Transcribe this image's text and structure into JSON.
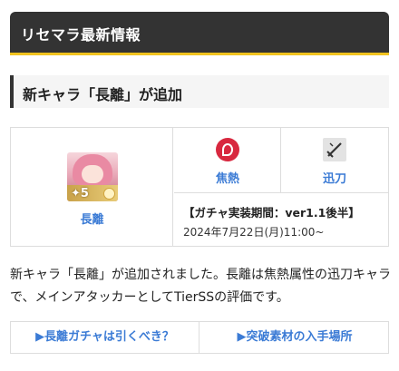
{
  "header": {
    "title": "リセマラ最新情報"
  },
  "sub_heading": {
    "text": "新キャラ「長離」が追加"
  },
  "character": {
    "rarity": "5",
    "name": "長離",
    "attribute": {
      "label": "焦熱",
      "icon": "fire-attribute-icon",
      "color": "#d8283f"
    },
    "weapon": {
      "label": "迅刀",
      "icon": "sword-weapon-icon"
    },
    "gacha_period": "【ガチャ実装期間：ver1.1後半】",
    "gacha_date": "2024年7月22日(月)11:00~"
  },
  "description": "新キャラ「長離」が追加されました。長離は焦熱属性の迅刀キャラで、メインアタッカーとしてTierSSの評価です。",
  "links": [
    {
      "label": "▶長離ガチャは引くべき？"
    },
    {
      "label": "▶突破素材の入手場所"
    }
  ],
  "colors": {
    "header_bg": "#333333",
    "accent_yellow": "#f1c31f",
    "link_blue": "#3b7bd5"
  }
}
